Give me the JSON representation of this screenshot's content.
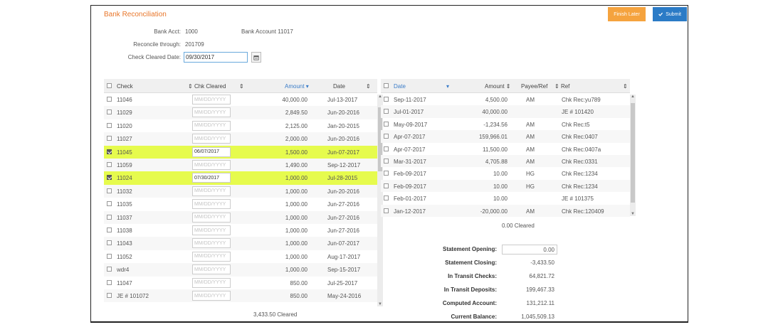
{
  "page": {
    "title": "Bank Reconciliation",
    "finish_later_label": "Finish Later",
    "submit_label": "Submit"
  },
  "header": {
    "bank_acct_label": "Bank Acct:",
    "bank_acct_value": "1000",
    "bank_acct_name": "Bank Account 11017",
    "reconcile_label": "Reconcile through:",
    "reconcile_value": "201709",
    "check_cleared_label": "Check Cleared Date:",
    "check_cleared_value": "09/30/2017"
  },
  "checks": {
    "columns": [
      "Check",
      "Chk Cleared",
      "Amount",
      "Date"
    ],
    "placeholder": "MM/DD/YYYY",
    "rows": [
      {
        "check": "11046",
        "cleared": "",
        "amount": "40,000.00",
        "date": "Jul-13-2017",
        "checked": false
      },
      {
        "check": "11029",
        "cleared": "",
        "amount": "2,849.50",
        "date": "Jun-20-2016",
        "checked": false
      },
      {
        "check": "11020",
        "cleared": "",
        "amount": "2,125.00",
        "date": "Jan-20-2015",
        "checked": false
      },
      {
        "check": "11027",
        "cleared": "",
        "amount": "2,000.00",
        "date": "Jun-20-2016",
        "checked": false
      },
      {
        "check": "11045",
        "cleared": "06/07/2017",
        "amount": "1,500.00",
        "date": "Jun-07-2017",
        "checked": true
      },
      {
        "check": "11059",
        "cleared": "",
        "amount": "1,490.00",
        "date": "Sep-12-2017",
        "checked": false
      },
      {
        "check": "11024",
        "cleared": "07/30/2017",
        "amount": "1,000.00",
        "date": "Jul-28-2015",
        "checked": true
      },
      {
        "check": "11032",
        "cleared": "",
        "amount": "1,000.00",
        "date": "Jun-20-2016",
        "checked": false
      },
      {
        "check": "11035",
        "cleared": "",
        "amount": "1,000.00",
        "date": "Jun-27-2016",
        "checked": false
      },
      {
        "check": "11037",
        "cleared": "",
        "amount": "1,000.00",
        "date": "Jun-27-2016",
        "checked": false
      },
      {
        "check": "11038",
        "cleared": "",
        "amount": "1,000.00",
        "date": "Jun-27-2016",
        "checked": false
      },
      {
        "check": "11043",
        "cleared": "",
        "amount": "1,000.00",
        "date": "Jun-07-2017",
        "checked": false
      },
      {
        "check": "11052",
        "cleared": "",
        "amount": "1,000.00",
        "date": "Aug-17-2017",
        "checked": false
      },
      {
        "check": "wdr4",
        "cleared": "",
        "amount": "1,000.00",
        "date": "Sep-15-2017",
        "checked": false
      },
      {
        "check": "11047",
        "cleared": "",
        "amount": "850.00",
        "date": "Jul-25-2017",
        "checked": false
      },
      {
        "check": "JE # 101072",
        "cleared": "",
        "amount": "850.00",
        "date": "May-24-2016",
        "checked": false,
        "link": true
      }
    ],
    "cleared_total": "3,433.50 Cleared"
  },
  "deposits": {
    "columns": [
      "Date",
      "Amount",
      "Payee/Ref",
      "Ref"
    ],
    "rows": [
      {
        "date": "Sep-11-2017",
        "amount": "4,500.00",
        "payee": "AM",
        "ref": "Chk Rec:yu789"
      },
      {
        "date": "Jul-01-2017",
        "amount": "40,000.00",
        "payee": "",
        "ref": "JE # 101420",
        "link": true
      },
      {
        "date": "May-09-2017",
        "amount": "-1,234.56",
        "payee": "AM",
        "ref": "Chk Rec:t5"
      },
      {
        "date": "Apr-07-2017",
        "amount": "159,966.01",
        "payee": "AM",
        "ref": "Chk Rec:0407"
      },
      {
        "date": "Apr-07-2017",
        "amount": "11,500.00",
        "payee": "AM",
        "ref": "Chk Rec:0407a"
      },
      {
        "date": "Mar-31-2017",
        "amount": "4,705.88",
        "payee": "AM",
        "ref": "Chk Rec:0331"
      },
      {
        "date": "Feb-09-2017",
        "amount": "10.00",
        "payee": "HG",
        "ref": "Chk Rec:1234"
      },
      {
        "date": "Feb-09-2017",
        "amount": "10.00",
        "payee": "HG",
        "ref": "Chk Rec:1234"
      },
      {
        "date": "Feb-01-2017",
        "amount": "10.00",
        "payee": "",
        "ref": "JE # 101375",
        "link": true
      },
      {
        "date": "Jan-12-2017",
        "amount": "-20,000.00",
        "payee": "AM",
        "ref": "Chk Rec:120409"
      }
    ],
    "cleared_total": "0.00 Cleared"
  },
  "summary": {
    "statement_opening_label": "Statement Opening:",
    "statement_opening_value": "0.00",
    "statement_closing_label": "Statement Closing:",
    "statement_closing_value": "-3,433.50",
    "in_transit_checks_label": "In Transit Checks:",
    "in_transit_checks_value": "64,821.72",
    "in_transit_deposits_label": "In Transit Deposits:",
    "in_transit_deposits_value": "199,467.33",
    "computed_account_label": "Computed Account:",
    "computed_account_value": "131,212.11",
    "current_balance_label": "Current Balance:",
    "current_balance_value": "1,045,509.13"
  },
  "colors": {
    "title": "#e8762a",
    "finish_later": "#f5a33e",
    "submit": "#2b7bc6",
    "highlight": "#e6fb4d",
    "link": "#3a7cc8"
  }
}
